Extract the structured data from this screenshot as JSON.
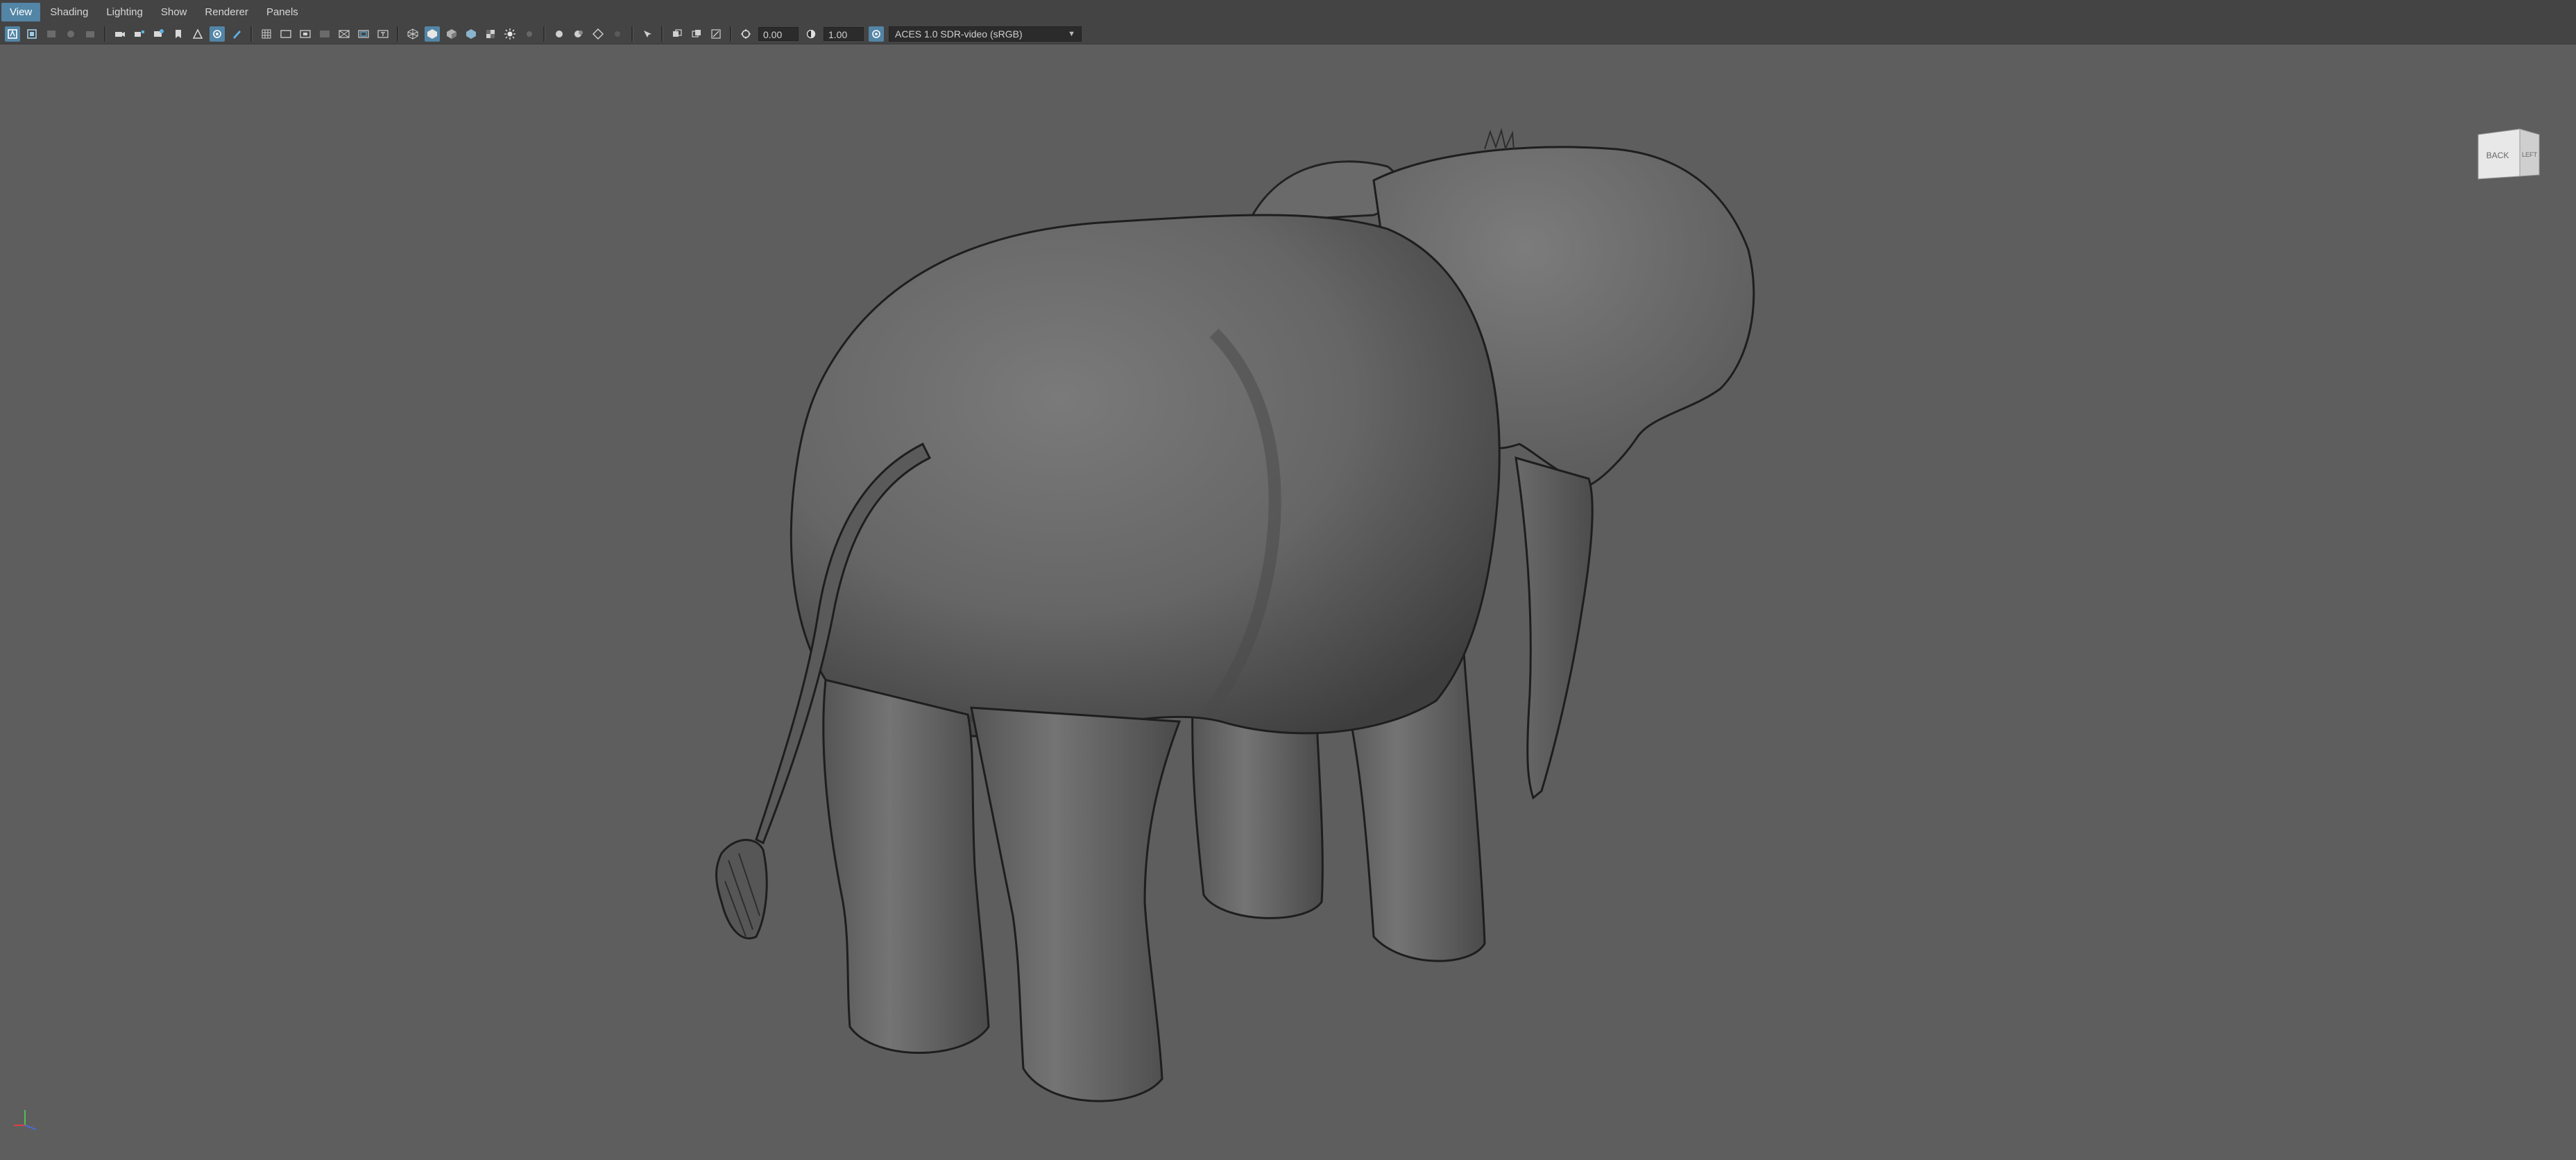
{
  "menu": {
    "items": [
      "View",
      "Shading",
      "Lighting",
      "Show",
      "Renderer",
      "Panels"
    ],
    "active": "View"
  },
  "toolbar": {
    "exposure_value": "0.00",
    "gamma_value": "1.00",
    "color_space": "ACES 1.0 SDR-video (sRGB)",
    "icons": [
      "select-camera-icon",
      "camera-attributes-icon",
      "bookmark-icon",
      "image-plane-icon",
      "camera-icon",
      "2d-pan-zoom-icon",
      "grease-pencil-icon",
      "grid-icon",
      "film-gate-icon",
      "resolution-gate-icon",
      "gate-mask-icon",
      "field-chart-icon",
      "safe-action-icon",
      "safe-title-icon",
      "wireframe-icon",
      "smooth-shade-icon",
      "default-material-icon",
      "textured-icon",
      "use-all-lights-icon",
      "shadows-icon",
      "screen-space-ao-icon",
      "motion-blur-icon",
      "anti-aliasing-icon",
      "depth-of-field-icon",
      "isolate-select-icon",
      "xray-icon",
      "xray-joints-icon",
      "backface-cull-icon",
      "exposure-icon",
      "gamma-icon",
      "color-management-icon"
    ]
  },
  "viewcube": {
    "face_back": "BACK",
    "face_left": "LEFT"
  },
  "colors": {
    "accent": "#5285a6",
    "viewport_bg": "#5e5e5e",
    "toolbar_bg": "#444444"
  }
}
